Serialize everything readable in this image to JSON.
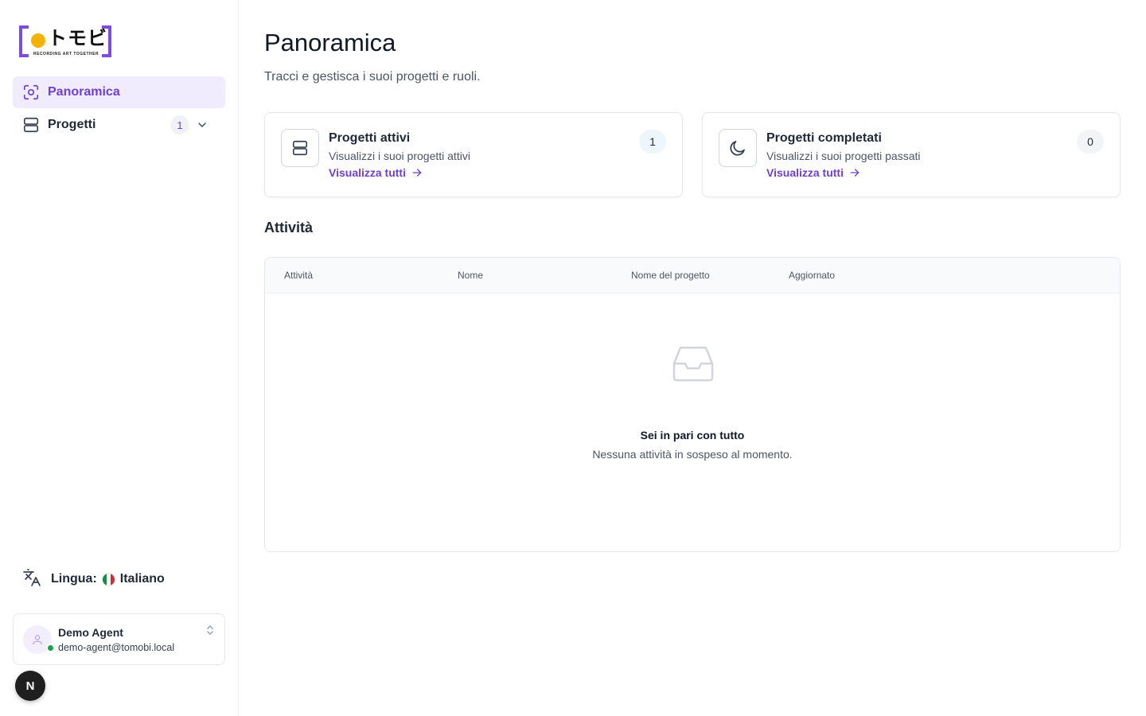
{
  "logo": {
    "kana": "トモビ",
    "tagline": "RECORDING ART TOGETHER",
    "brand_color": "#7c4ddb",
    "dot_color": "#f5b301"
  },
  "sidebar": {
    "items": [
      {
        "label": "Panoramica",
        "icon": "scan-face-icon",
        "active": true
      },
      {
        "label": "Progetti",
        "icon": "projects-icon",
        "badge": "1",
        "active": false
      }
    ],
    "language": {
      "label": "Lingua:",
      "value": "Italiano",
      "icon": "translate-icon",
      "flag": "italy-flag"
    },
    "user": {
      "name": "Demo Agent",
      "email": "demo-agent@tomobi.local",
      "status_color": "#16a34a"
    },
    "dev_badge": "N"
  },
  "main": {
    "title": "Panoramica",
    "subtitle": "Tracci e gestisca i suoi progetti e ruoli.",
    "cards": [
      {
        "title": "Progetti attivi",
        "description": "Visualizzi i suoi progetti attivi",
        "link": "Visualizza tutti",
        "count": "1",
        "icon": "projects-icon"
      },
      {
        "title": "Progetti completati",
        "description": "Visualizzi i suoi progetti passati",
        "link": "Visualizza tutti",
        "count": "0",
        "icon": "moon-icon"
      }
    ],
    "activity": {
      "title": "Attività",
      "columns": [
        "Attività",
        "Nome",
        "Nome del progetto",
        "Aggiornato"
      ],
      "rows": [],
      "empty_title": "Sei in pari con tutto",
      "empty_description": "Nessuna attività in sospeso al momento."
    }
  },
  "colors": {
    "accent": "#6d3fd6",
    "active_bg": "#f1ecfd"
  }
}
